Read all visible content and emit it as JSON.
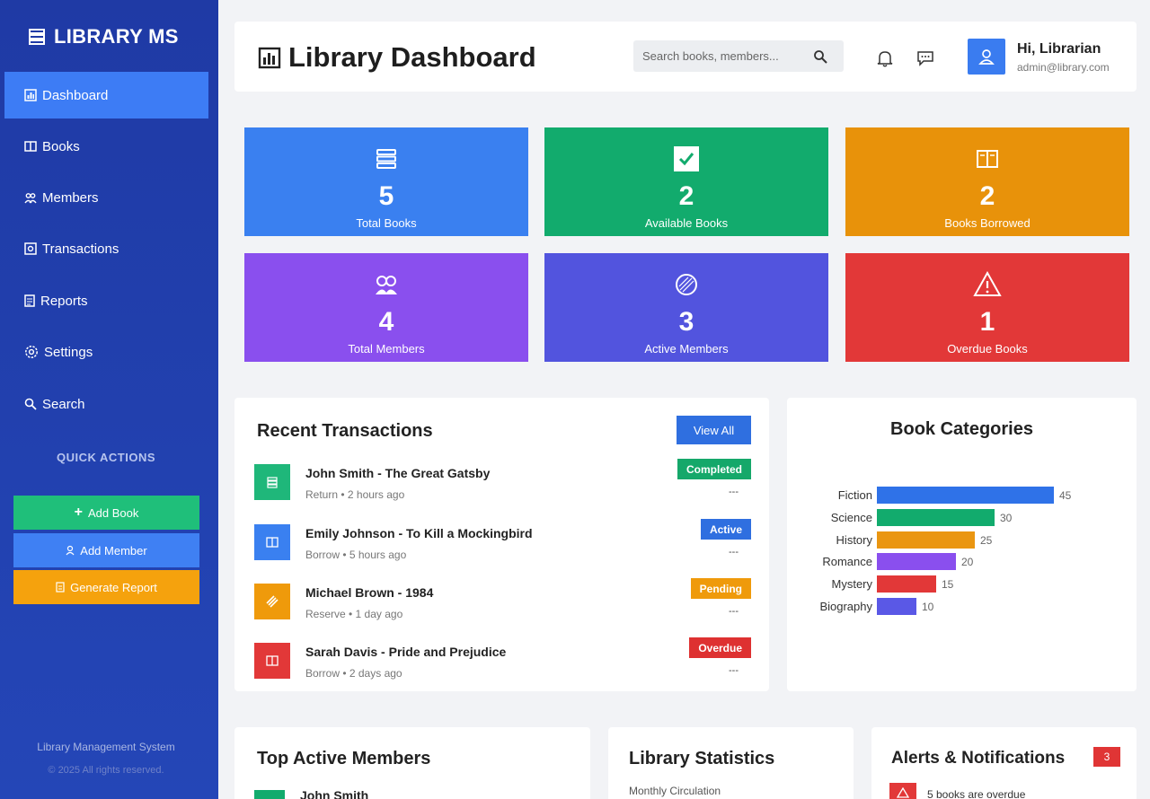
{
  "sidebar": {
    "brand": "LIBRARY MS",
    "items": [
      {
        "label": "Dashboard",
        "icon": "chart-icon"
      },
      {
        "label": "Books",
        "icon": "book-icon"
      },
      {
        "label": "Members",
        "icon": "members-icon"
      },
      {
        "label": "Transactions",
        "icon": "transactions-icon"
      },
      {
        "label": "Reports",
        "icon": "report-icon"
      },
      {
        "label": "Settings",
        "icon": "gear-icon"
      },
      {
        "label": "Search",
        "icon": "search-icon"
      }
    ],
    "quick_actions_title": "QUICK ACTIONS",
    "quick_actions": [
      {
        "label": "Add Book",
        "color": "#1fbf7a"
      },
      {
        "label": "Add Member",
        "color": "#3f80f3"
      },
      {
        "label": "Generate Report",
        "color": "#f5a20d"
      }
    ],
    "footer_line1": "Library Management System",
    "footer_line2": "© 2025 All rights reserved."
  },
  "header": {
    "title": "Library Dashboard",
    "search_placeholder": "Search books, members...",
    "greeting": "Hi, Librarian",
    "email": "admin@library.com"
  },
  "stats": [
    {
      "value": "5",
      "label": "Total Books",
      "color": "#3a80f0",
      "icon": "books-stack-icon"
    },
    {
      "value": "2",
      "label": "Available Books",
      "color": "#12ab6d",
      "icon": "checkmark-icon"
    },
    {
      "value": "2",
      "label": "Books Borrowed",
      "color": "#e8920a",
      "icon": "open-book-icon"
    },
    {
      "value": "4",
      "label": "Total Members",
      "color": "#8a4fee",
      "icon": "members-icon"
    },
    {
      "value": "3",
      "label": "Active Members",
      "color": "#5254de",
      "icon": "circle-icon"
    },
    {
      "value": "1",
      "label": "Overdue Books",
      "color": "#e23838",
      "icon": "warning-icon"
    }
  ],
  "transactions": {
    "title": "Recent Transactions",
    "view_all": "View All",
    "items": [
      {
        "title": "John Smith - The Great Gatsby",
        "sub": "Return • 2 hours ago",
        "badge": "Completed",
        "badge_color": "#15a86a",
        "icon_color": "#1fb77a",
        "dash": "---"
      },
      {
        "title": "Emily Johnson - To Kill a Mockingbird",
        "sub": "Borrow • 5 hours ago",
        "badge": "Active",
        "badge_color": "#2f6fe0",
        "icon_color": "#3a80f0",
        "dash": "---"
      },
      {
        "title": "Michael Brown - 1984",
        "sub": "Reserve • 1 day ago",
        "badge": "Pending",
        "badge_color": "#ef9a0b",
        "icon_color": "#ef9a0b",
        "dash": "---"
      },
      {
        "title": "Sarah Davis - Pride and Prejudice",
        "sub": "Borrow • 2 days ago",
        "badge": "Overdue",
        "badge_color": "#de3131",
        "icon_color": "#e23838",
        "dash": "---"
      }
    ]
  },
  "chart_data": {
    "type": "bar",
    "orientation": "horizontal",
    "title": "Book Categories",
    "categories": [
      "Fiction",
      "Science",
      "History",
      "Romance",
      "Mystery",
      "Biography"
    ],
    "values": [
      45,
      30,
      25,
      20,
      15,
      10
    ],
    "colors": [
      "#2f72e8",
      "#12ab6d",
      "#ea9611",
      "#8a4fee",
      "#e23838",
      "#5a58e6"
    ],
    "grid": false,
    "legend": "none"
  },
  "bottom": {
    "members_title": "Top Active Members",
    "members_first": "John Smith",
    "stats_title": "Library Statistics",
    "stats_sub": "Monthly Circulation",
    "alerts_title": "Alerts & Notifications",
    "alerts_count": "3",
    "alert_first": "5 books are overdue"
  }
}
